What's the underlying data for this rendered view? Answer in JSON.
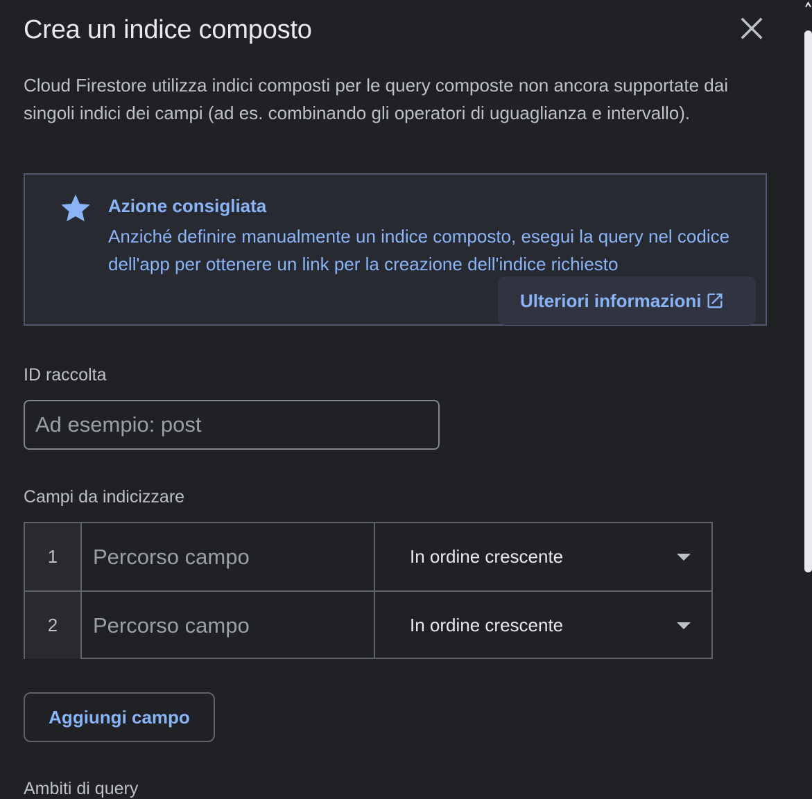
{
  "dialog": {
    "title": "Crea un indice composto",
    "description": "Cloud Firestore utilizza indici composti per le query composte non ancora supportate dai singoli indici dei campi (ad es. combinando gli operatori di uguaglianza e intervallo)."
  },
  "banner": {
    "heading": "Azione consigliata",
    "text": "Anziché definire manualmente un indice composto, esegui la query nel codice dell'app per ottenere un link per la creazione dell'indice richiesto",
    "button_label": "Ulteriori informazioni",
    "icon": "star-icon",
    "button_icon": "open-in-new-icon"
  },
  "collection": {
    "label": "ID raccolta",
    "placeholder": "Ad esempio: post",
    "value": ""
  },
  "fields": {
    "label": "Campi da indicizzare",
    "rows": [
      {
        "index": "1",
        "path_placeholder": "Percorso campo",
        "order": "In ordine crescente"
      },
      {
        "index": "2",
        "path_placeholder": "Percorso campo",
        "order": "In ordine crescente"
      }
    ],
    "add_button": "Aggiungi campo"
  },
  "query_scope": {
    "label": "Ambiti di query"
  },
  "colors": {
    "background": "#202124",
    "accent": "#8ab4f8",
    "banner_bg": "#282a32",
    "banner_border": "#4f5872",
    "border": "#5f6368"
  }
}
